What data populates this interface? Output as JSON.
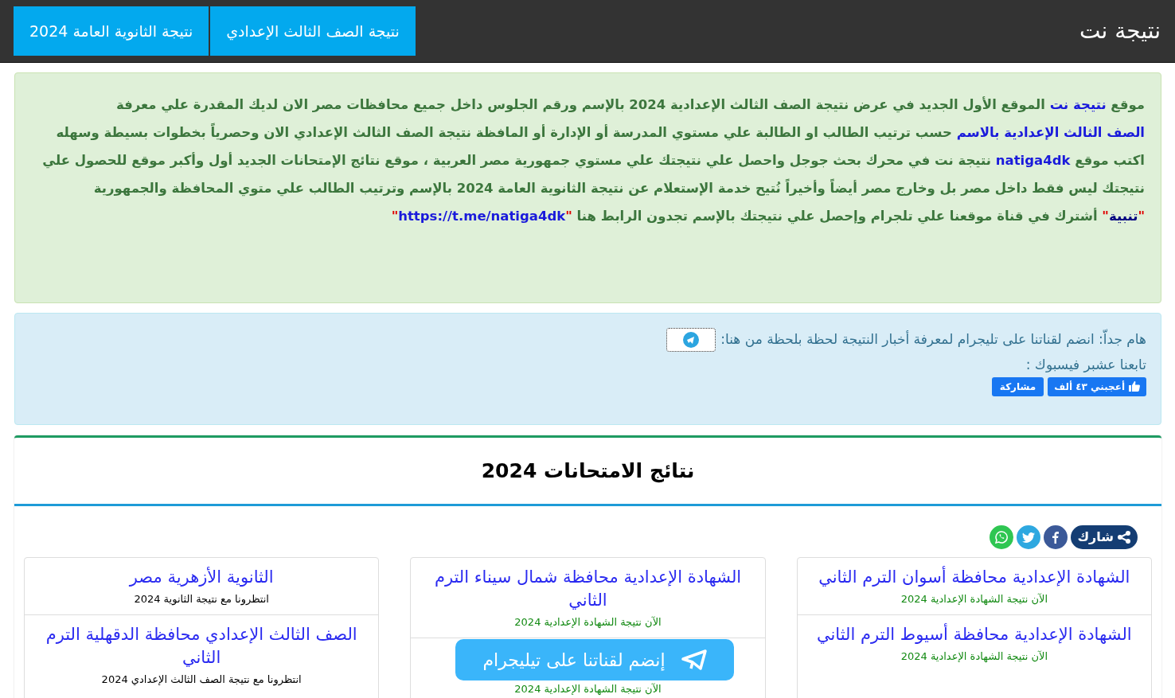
{
  "header": {
    "site_title": "نتيجة نت",
    "nav_buttons": [
      "نتيجة الصف الثالث الإعدادي",
      "نتيجة الثانوية العامة 2024"
    ]
  },
  "intro": {
    "paragraph": [
      {
        "kind": "text",
        "text": "موقع "
      },
      {
        "kind": "link",
        "text": "نتيجة نت"
      },
      {
        "kind": "text",
        "text": " الموقع الأول الجديد في عرض نتيجة الصف الثالث الإعدادية 2024 بالإسم ورقم الجلوس داخل جميع محافظات مصر الان لديك المقدرة علي معرفة "
      },
      {
        "kind": "link",
        "text": "الصف الثالث الإعدادية بالاسم"
      },
      {
        "kind": "text",
        "text": " حسب ترتيب الطالب او الطالبة علي مستوي المدرسة أو الإدارة أو المافظة نتيجة الصف الثالث الإعدادي الان وحصرياً بخطوات بسيطة وسهله اكتب موقع "
      },
      {
        "kind": "link",
        "text": "natiga4dk"
      },
      {
        "kind": "text",
        "text": " نتيجة نت في محرك بحث جوجل واحصل علي نتيجتك علي مستوي جمهورية مصر العربية ، موقع نتائج الإمتحانات الجديد أول وأكبر موقع للحصول علي نتيجتك ليس فقط داخل مصر بل وخارج مصر أيضاً وأخيراً نُتيح خدمة الإستعلام عن نتيجة الثانوية العامة 2024 بالإسم وترتيب الطالب علي متوي المحافظة والجمهورية"
      }
    ],
    "notice": [
      {
        "kind": "quote",
        "text": "\""
      },
      {
        "kind": "label",
        "text": "تنبية"
      },
      {
        "kind": "quote",
        "text": "\""
      },
      {
        "kind": "text",
        "text": " أشترك في قناة موقعنا علي تلجرام وإحصل علي نتيجتك بالإسم تجدون الرابط هنا "
      },
      {
        "kind": "quote",
        "text": "\""
      },
      {
        "kind": "link",
        "text": "https://t.me/natiga4dk"
      },
      {
        "kind": "quote",
        "text": "\""
      }
    ]
  },
  "social": {
    "telegram_text": "هام جداّ: انضم لقناتنا على تليجرام لمعرفة أخبار النتيجة لحظة بلحظة من هنا:",
    "facebook_text": "تابعنا عشبر فيسبوك :",
    "like_button": "أعجبني ٤٣ ألف",
    "share_button": "مشاركة"
  },
  "results": {
    "title": "نتائج الامتحانات 2024",
    "share_label": "شارك",
    "columns": [
      {
        "items": [
          {
            "title": "الشهادة الإعدادية محافظة أسوان الترم الثاني",
            "subtitle": "الآن نتيجة الشهادة الإعدادية 2024",
            "kind": "available"
          },
          {
            "title": "الشهادة الإعدادية محافظة أسيوط الترم الثاني",
            "subtitle": "الآن نتيجة الشهادة الإعدادية 2024",
            "kind": "available"
          }
        ]
      },
      {
        "items": [
          {
            "title": "الشهادة الإعدادية محافظة شمال سيناء الترم الثاني",
            "subtitle": "الآن نتيجة الشهادة الإعدادية 2024",
            "kind": "available"
          },
          {
            "subtitle": "الآن نتيجة الشهادة الإعدادية 2024",
            "kind": "available"
          }
        ]
      },
      {
        "items": [
          {
            "title": "الثانوية الأزهرية مصر",
            "subtitle": "انتظرونا مع نتيجة الثانوية 2024",
            "kind": "pending"
          },
          {
            "title": "الصف الثالث الإعدادي محافظة الدقهلية الترم الثاني",
            "subtitle": "انتظرونا مع نتيجة الصف الثالث الإعدادي 2024",
            "kind": "pending"
          }
        ]
      }
    ]
  },
  "floating_button": "إنضم لقناتنا على تيليجرام"
}
